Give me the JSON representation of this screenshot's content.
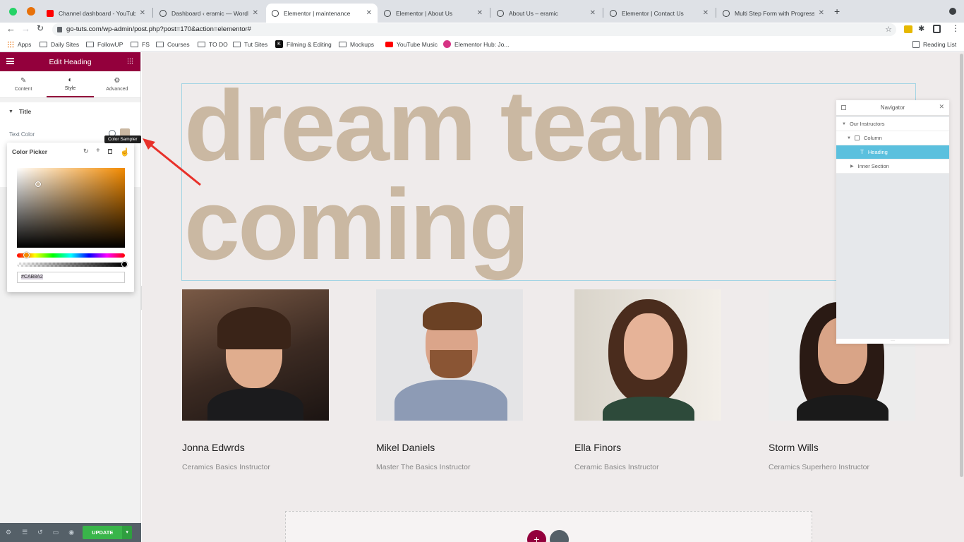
{
  "browser": {
    "tabs": [
      {
        "title": "Channel dashboard - YouTube",
        "fav_color": "#ff0000",
        "active": false
      },
      {
        "title": "Dashboard ‹ eramic — WordPr",
        "fav_color": "#3c4043",
        "active": false
      },
      {
        "title": "Elementor | maintenance",
        "fav_color": "#3c4043",
        "active": true
      },
      {
        "title": "Elementor | About Us",
        "fav_color": "#3c4043",
        "active": false
      },
      {
        "title": "About Us – eramic",
        "fav_color": "#3c4043",
        "active": false
      },
      {
        "title": "Elementor | Contact Us",
        "fav_color": "#3c4043",
        "active": false
      },
      {
        "title": "Multi Step Form with Progress",
        "fav_color": "#3c4043",
        "active": false
      }
    ],
    "url": "go-tuts.com/wp-admin/post.php?post=170&action=elementor#",
    "bookmarks": [
      {
        "label": "Apps",
        "icon": "apps-grid-icon"
      },
      {
        "label": "Daily Sites",
        "icon": "folder-icon"
      },
      {
        "label": "FollowUP",
        "icon": "folder-icon"
      },
      {
        "label": "FS",
        "icon": "folder-icon"
      },
      {
        "label": "Courses",
        "icon": "folder-icon"
      },
      {
        "label": "TO DO",
        "icon": "folder-icon"
      },
      {
        "label": "Tut Sites",
        "icon": "folder-icon"
      },
      {
        "label": "Filming & Editing",
        "icon": "k-icon"
      },
      {
        "label": "Mockups",
        "icon": "folder-icon"
      },
      {
        "label": "YouTube Music",
        "icon": "youtube-music-icon"
      },
      {
        "label": "Elementor Hub: Jo...",
        "icon": "elementor-icon"
      }
    ],
    "reading_list": "Reading List"
  },
  "panel": {
    "header_title": "Edit Heading",
    "tabs": [
      {
        "label": "Content",
        "icon": "pencil-icon"
      },
      {
        "label": "Style",
        "icon": "contrast-icon"
      },
      {
        "label": "Advanced",
        "icon": "gear-icon"
      }
    ],
    "section_title": "Title",
    "text_color_label": "Text Color",
    "tooltip": "Color Sampler",
    "color_picker": {
      "title": "Color Picker",
      "hex_value": "#CAB8A2"
    },
    "update_button": "UPDATE"
  },
  "canvas": {
    "heading_lines": [
      "dream team",
      "coming"
    ],
    "heading_color": "#cab8a2",
    "instructors": [
      {
        "name": "Jonna Edwrds",
        "role": "Ceramics Basics Instructor"
      },
      {
        "name": "Mikel Daniels",
        "role": "Master The Basics Instructor"
      },
      {
        "name": "Ella Finors",
        "role": "Ceramic Basics Instructor"
      },
      {
        "name": "Storm Wills",
        "role": "Ceramics Superhero Instructor"
      }
    ]
  },
  "navigator": {
    "title": "Navigator",
    "items": [
      {
        "label": "Our Instructors"
      },
      {
        "label": "Column"
      },
      {
        "label": "Heading"
      },
      {
        "label": "Inner Section"
      }
    ]
  },
  "colors": {
    "elementor_brand": "#93003c",
    "update_green": "#39b54a",
    "navigator_selected": "#5bc0de"
  }
}
